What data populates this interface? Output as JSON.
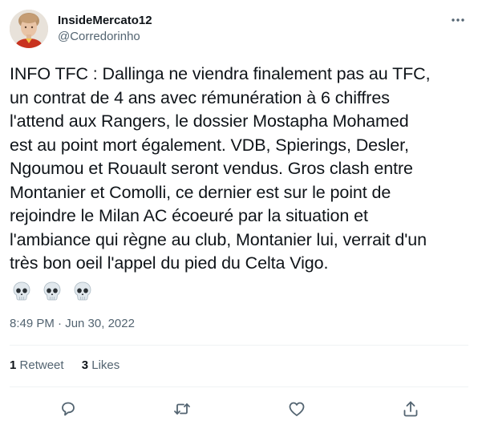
{
  "user": {
    "display_name": "InsideMercato12",
    "handle": "@Corredorinho",
    "avatar_icon": "profile-photo"
  },
  "tweet": {
    "text": "INFO TFC : Dallinga ne viendra finalement pas au TFC,\nun contrat de 4 ans avec rémunération à 6 chiffres\nl'attend aux Rangers, le dossier Mostapha Mohamed\nest au point mort également. VDB, Spierings, Desler,\nNgoumou et Rouault seront vendus. Gros clash entre\nMontanier et Comolli, ce dernier est sur le point de\nrejoindre le Milan AC écoeuré par la situation et\nl'ambiance qui règne au club, Montanier lui, verrait d'un\ntrès bon oeil l'appel du pied du Celta Vigo.",
    "emojis": [
      "skull",
      "skull",
      "skull"
    ],
    "timestamp": "8:49 PM · Jun 30, 2022"
  },
  "stats": {
    "retweets_count": "1",
    "retweets_label": "Retweet",
    "likes_count": "3",
    "likes_label": "Likes"
  },
  "actions": [
    "reply-icon",
    "retweet-icon",
    "like-icon",
    "share-icon"
  ],
  "colors": {
    "text": "#0f1419",
    "secondary": "#536471",
    "divider": "#eff3f4"
  }
}
